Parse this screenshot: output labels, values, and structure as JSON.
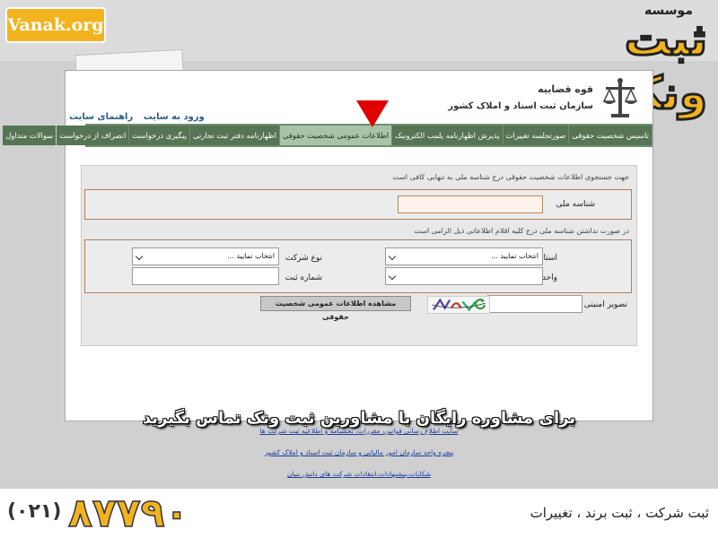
{
  "colors": {
    "accent_yellow": "#f2b31f",
    "nav_green": "#6f8f6f",
    "nav_tab": "#557555",
    "nav_active": "#a8c4a8",
    "link_blue": "#1d3f9a",
    "pointer_red": "#e10000"
  },
  "promo": {
    "site": "Vanak.org",
    "brand_prefix": "موسسه",
    "brand_name": "ثبت ونک"
  },
  "header": {
    "org_line1": "قوه قضاییه",
    "org_line2": "سازمان ثبت اسناد و املاک کشور",
    "links": [
      "ورود به سایت",
      "راهنمای سایت"
    ]
  },
  "nav": {
    "tabs": [
      "تاسیس شخصیت حقوقی",
      "صورتجلسه تغییرات",
      "پذیرش اظهارنامه پلمب الکترونیک",
      "اطلاعات عمومی شخصیت حقوقی",
      "اظهارنامه دفتر ثبت تجارتی",
      "پیگیری درخواست",
      "انصراف از درخواست",
      "سوالات متداول"
    ],
    "active_index": 3
  },
  "form": {
    "hint_national": "جهت جستجوی اطلاعات شخصیت حقوقی درج شناسه ملی به تنهایی کافی است",
    "national_id_label": "شناسه ملی",
    "national_id_value": "",
    "hint_other": "در صورت نداشتن شناسه ملی درج کلیه اقلام اطلاعاتی ذیل الزامی است",
    "province_label": "استان",
    "province_value": "انتخاب نمایید ...",
    "company_type_label": "نوع شرکت",
    "company_type_value": "انتخاب نمایید ...",
    "registry_unit_label": "واحد ثبتی",
    "registry_unit_value": "",
    "registration_number_label": "شماره ثبت",
    "registration_number_value": "",
    "captcha_label": "تصویر امنیتی",
    "captcha_value": "",
    "submit_label": "مشاهده اطلاعات عمومی شخصیت حقوقی"
  },
  "banner": {
    "text": "برای مشاوره رایگان با مشاورین ثبت ونک تماس بگیرید"
  },
  "footer_links": [
    "سایت اطلاع رسانی قوانین، مقررات، بخشنامه و اطلاعیه ثبت شرکت ها",
    "پنجره واحد سازمان امور مالیاتی و سازمان ثبت اسناد و املاک کشور",
    "شکایات،پیشنهادات،انتقادات شرکت های دانش بنیان"
  ],
  "contact": {
    "phone": "۸۷۷۹۰",
    "area_code": "(۰۲۱)",
    "services": "ثبت شرکت ، ثبت برند ، تغییرات"
  }
}
